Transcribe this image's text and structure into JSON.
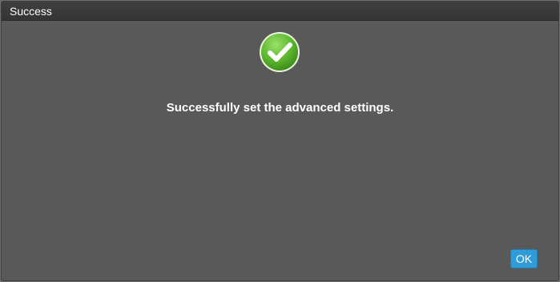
{
  "dialog": {
    "title": "Success",
    "icon": "check-circle-icon",
    "message": "Successfully set the advanced settings.",
    "ok_label": "OK"
  },
  "colors": {
    "dialog_bg": "#595959",
    "titlebar_bg": "#3a3a3a",
    "icon_green": "#5cb82e",
    "button_blue": "#2f9bd9"
  }
}
